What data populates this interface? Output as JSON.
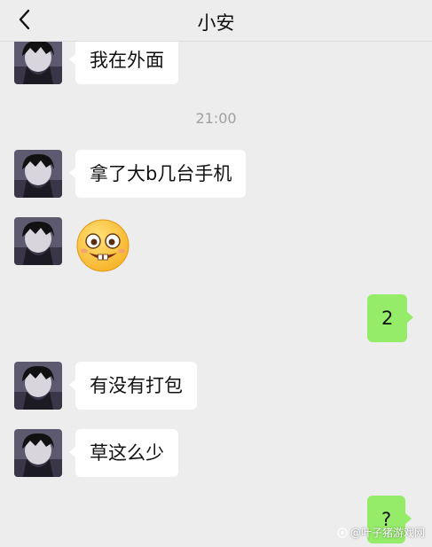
{
  "header": {
    "title": "小安"
  },
  "messages": [
    {
      "side": "left",
      "text": "我在外面"
    },
    {
      "time": "21:00"
    },
    {
      "side": "left",
      "text": "拿了大b几台手机"
    },
    {
      "side": "left",
      "sticker": "grinning-face-sticker"
    },
    {
      "side": "right",
      "text": "2"
    },
    {
      "side": "left",
      "text": "有没有打包"
    },
    {
      "side": "left",
      "text": "草这么少"
    },
    {
      "side": "right",
      "text": "?"
    }
  ],
  "watermark": {
    "text": "@叶子猪游戏网"
  },
  "colors": {
    "background": "#ededed",
    "incoming_bubble": "#ffffff",
    "outgoing_bubble": "#95ec69",
    "timestamp": "#a0a0a0"
  }
}
